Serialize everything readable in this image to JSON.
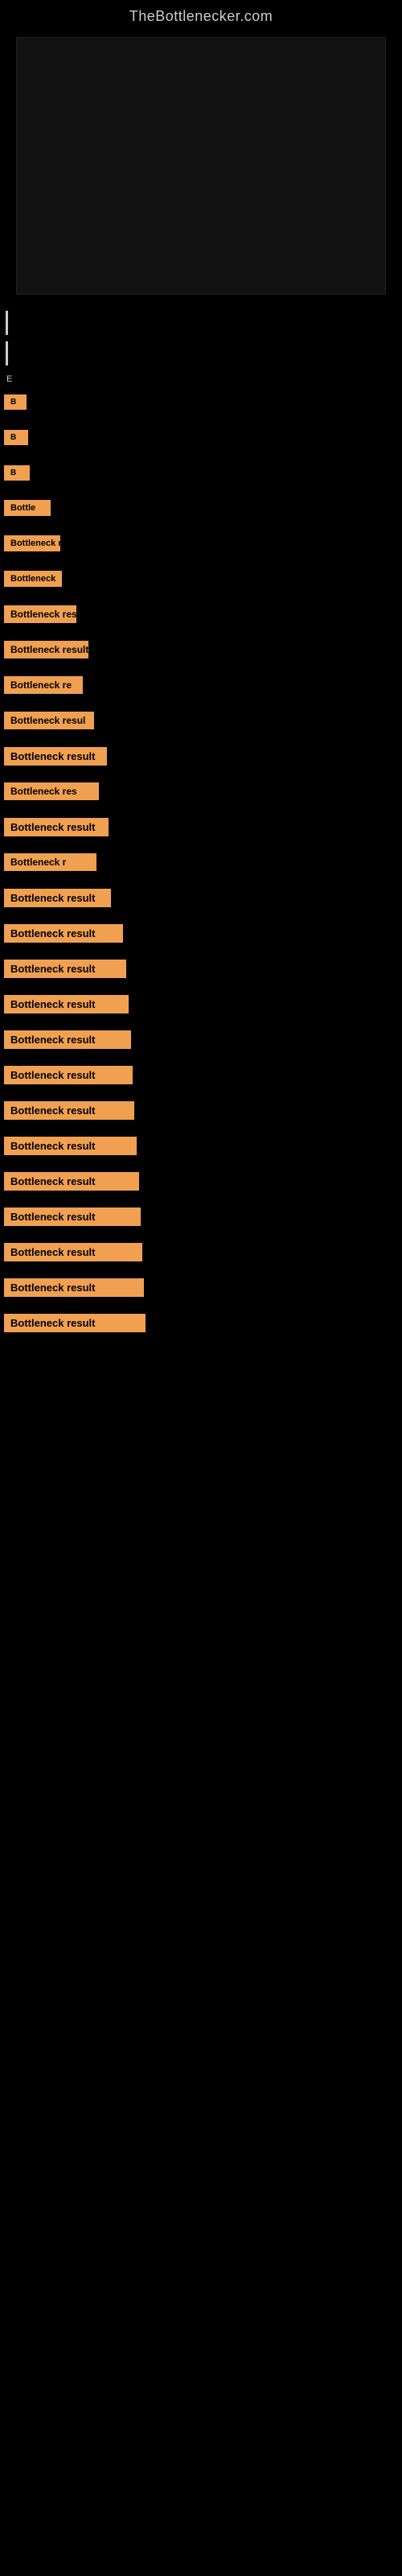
{
  "site": {
    "title": "TheBottlenecker.com"
  },
  "items": [
    {
      "id": 0,
      "label": "B"
    },
    {
      "id": 1,
      "label": "B"
    },
    {
      "id": 2,
      "label": "B"
    },
    {
      "id": 3,
      "label": "Bottle"
    },
    {
      "id": 4,
      "label": "Bottleneck r"
    },
    {
      "id": 5,
      "label": "Bottleneck"
    },
    {
      "id": 6,
      "label": "Bottleneck res"
    },
    {
      "id": 7,
      "label": "Bottleneck result"
    },
    {
      "id": 8,
      "label": "Bottleneck re"
    },
    {
      "id": 9,
      "label": "Bottleneck resul"
    },
    {
      "id": 10,
      "label": "Bottleneck result"
    },
    {
      "id": 11,
      "label": "Bottleneck res"
    },
    {
      "id": 12,
      "label": "Bottleneck result"
    },
    {
      "id": 13,
      "label": "Bottleneck r"
    },
    {
      "id": 14,
      "label": "Bottleneck result"
    },
    {
      "id": 15,
      "label": "Bottleneck result"
    },
    {
      "id": 16,
      "label": "Bottleneck result"
    },
    {
      "id": 17,
      "label": "Bottleneck result"
    },
    {
      "id": 18,
      "label": "Bottleneck result"
    },
    {
      "id": 19,
      "label": "Bottleneck result"
    },
    {
      "id": 20,
      "label": "Bottleneck result"
    },
    {
      "id": 21,
      "label": "Bottleneck result"
    },
    {
      "id": 22,
      "label": "Bottleneck result"
    },
    {
      "id": 23,
      "label": "Bottleneck result"
    },
    {
      "id": 24,
      "label": "Bottleneck result"
    },
    {
      "id": 25,
      "label": "Bottleneck result"
    },
    {
      "id": 26,
      "label": "Bottleneck result"
    }
  ]
}
